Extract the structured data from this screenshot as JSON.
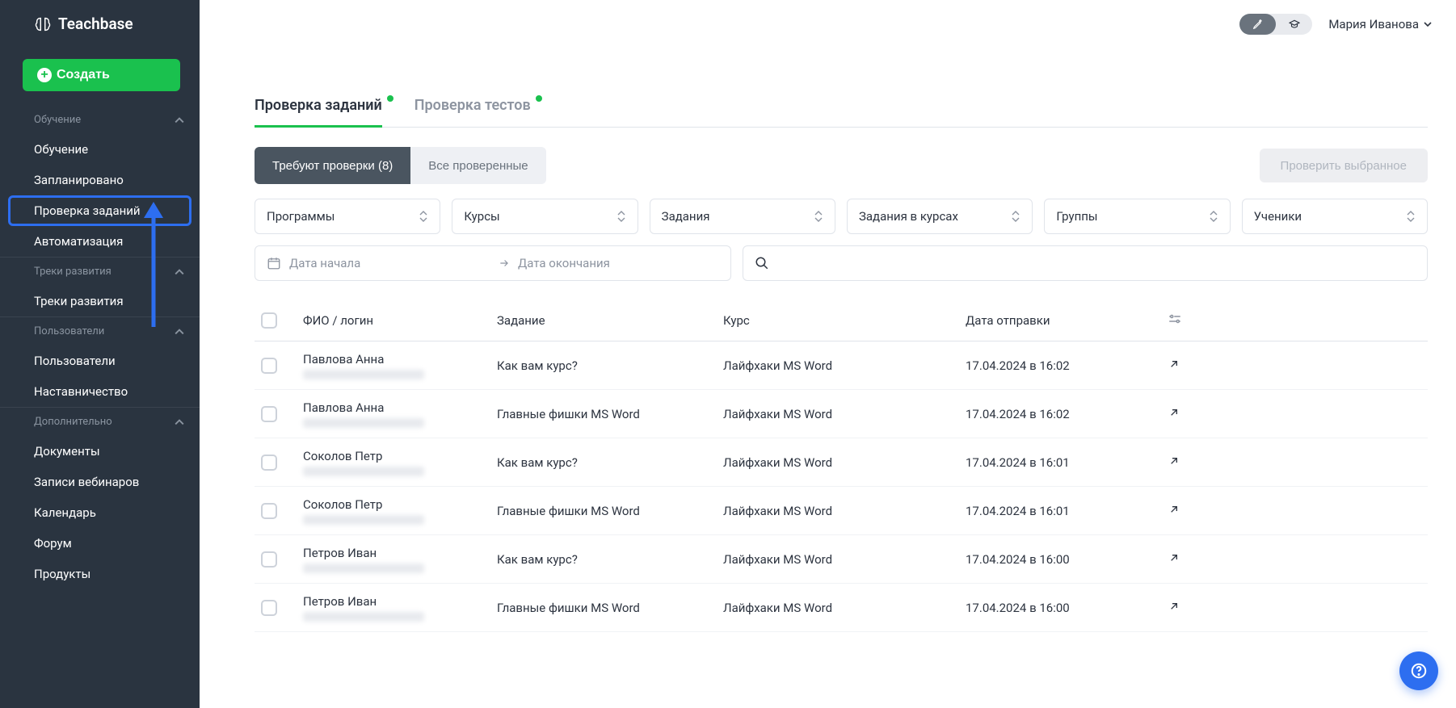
{
  "brand": "Teachbase",
  "create_label": "Создать",
  "sidebar": {
    "sections": [
      {
        "header": "Обучение",
        "items": [
          "Обучение",
          "Запланировано",
          "Проверка заданий",
          "Автоматизация"
        ],
        "active_index": 2
      },
      {
        "header": "Треки развития",
        "items": [
          "Треки развития"
        ]
      },
      {
        "header": "Пользователи",
        "items": [
          "Пользователи",
          "Наставничество"
        ]
      },
      {
        "header": "Дополнительно",
        "items": [
          "Документы",
          "Записи вебинаров",
          "Календарь",
          "Форум",
          "Продукты"
        ]
      }
    ]
  },
  "user_name": "Мария Иванова",
  "tabs": [
    {
      "label": "Проверка заданий",
      "active": true,
      "dot": true
    },
    {
      "label": "Проверка тестов",
      "active": false,
      "dot": true
    }
  ],
  "seg_buttons": {
    "need_check": "Требуют проверки (8)",
    "all_checked": "Все проверенные"
  },
  "check_selected": "Проверить выбранное",
  "filters": [
    "Программы",
    "Курсы",
    "Задания",
    "Задания в курсах",
    "Группы",
    "Ученики"
  ],
  "date_range": {
    "start_placeholder": "Дата начала",
    "end_placeholder": "Дата окончания"
  },
  "table": {
    "headers": {
      "name": "ФИО / логин",
      "task": "Задание",
      "course": "Курс",
      "sent": "Дата отправки"
    },
    "rows": [
      {
        "name": "Павлова Анна",
        "task": "Как вам курс?",
        "course": "Лайфхаки MS Word",
        "sent": "17.04.2024 в 16:02"
      },
      {
        "name": "Павлова Анна",
        "task": "Главные фишки MS Word",
        "course": "Лайфхаки MS Word",
        "sent": "17.04.2024 в 16:02"
      },
      {
        "name": "Соколов Петр",
        "task": "Как вам курс?",
        "course": "Лайфхаки MS Word",
        "sent": "17.04.2024 в 16:01"
      },
      {
        "name": "Соколов Петр",
        "task": "Главные фишки MS Word",
        "course": "Лайфхаки MS Word",
        "sent": "17.04.2024 в 16:01"
      },
      {
        "name": "Петров Иван",
        "task": "Как вам курс?",
        "course": "Лайфхаки MS Word",
        "sent": "17.04.2024 в 16:00"
      },
      {
        "name": "Петров Иван",
        "task": "Главные фишки MS Word",
        "course": "Лайфхаки MS Word",
        "sent": "17.04.2024 в 16:00"
      }
    ]
  }
}
